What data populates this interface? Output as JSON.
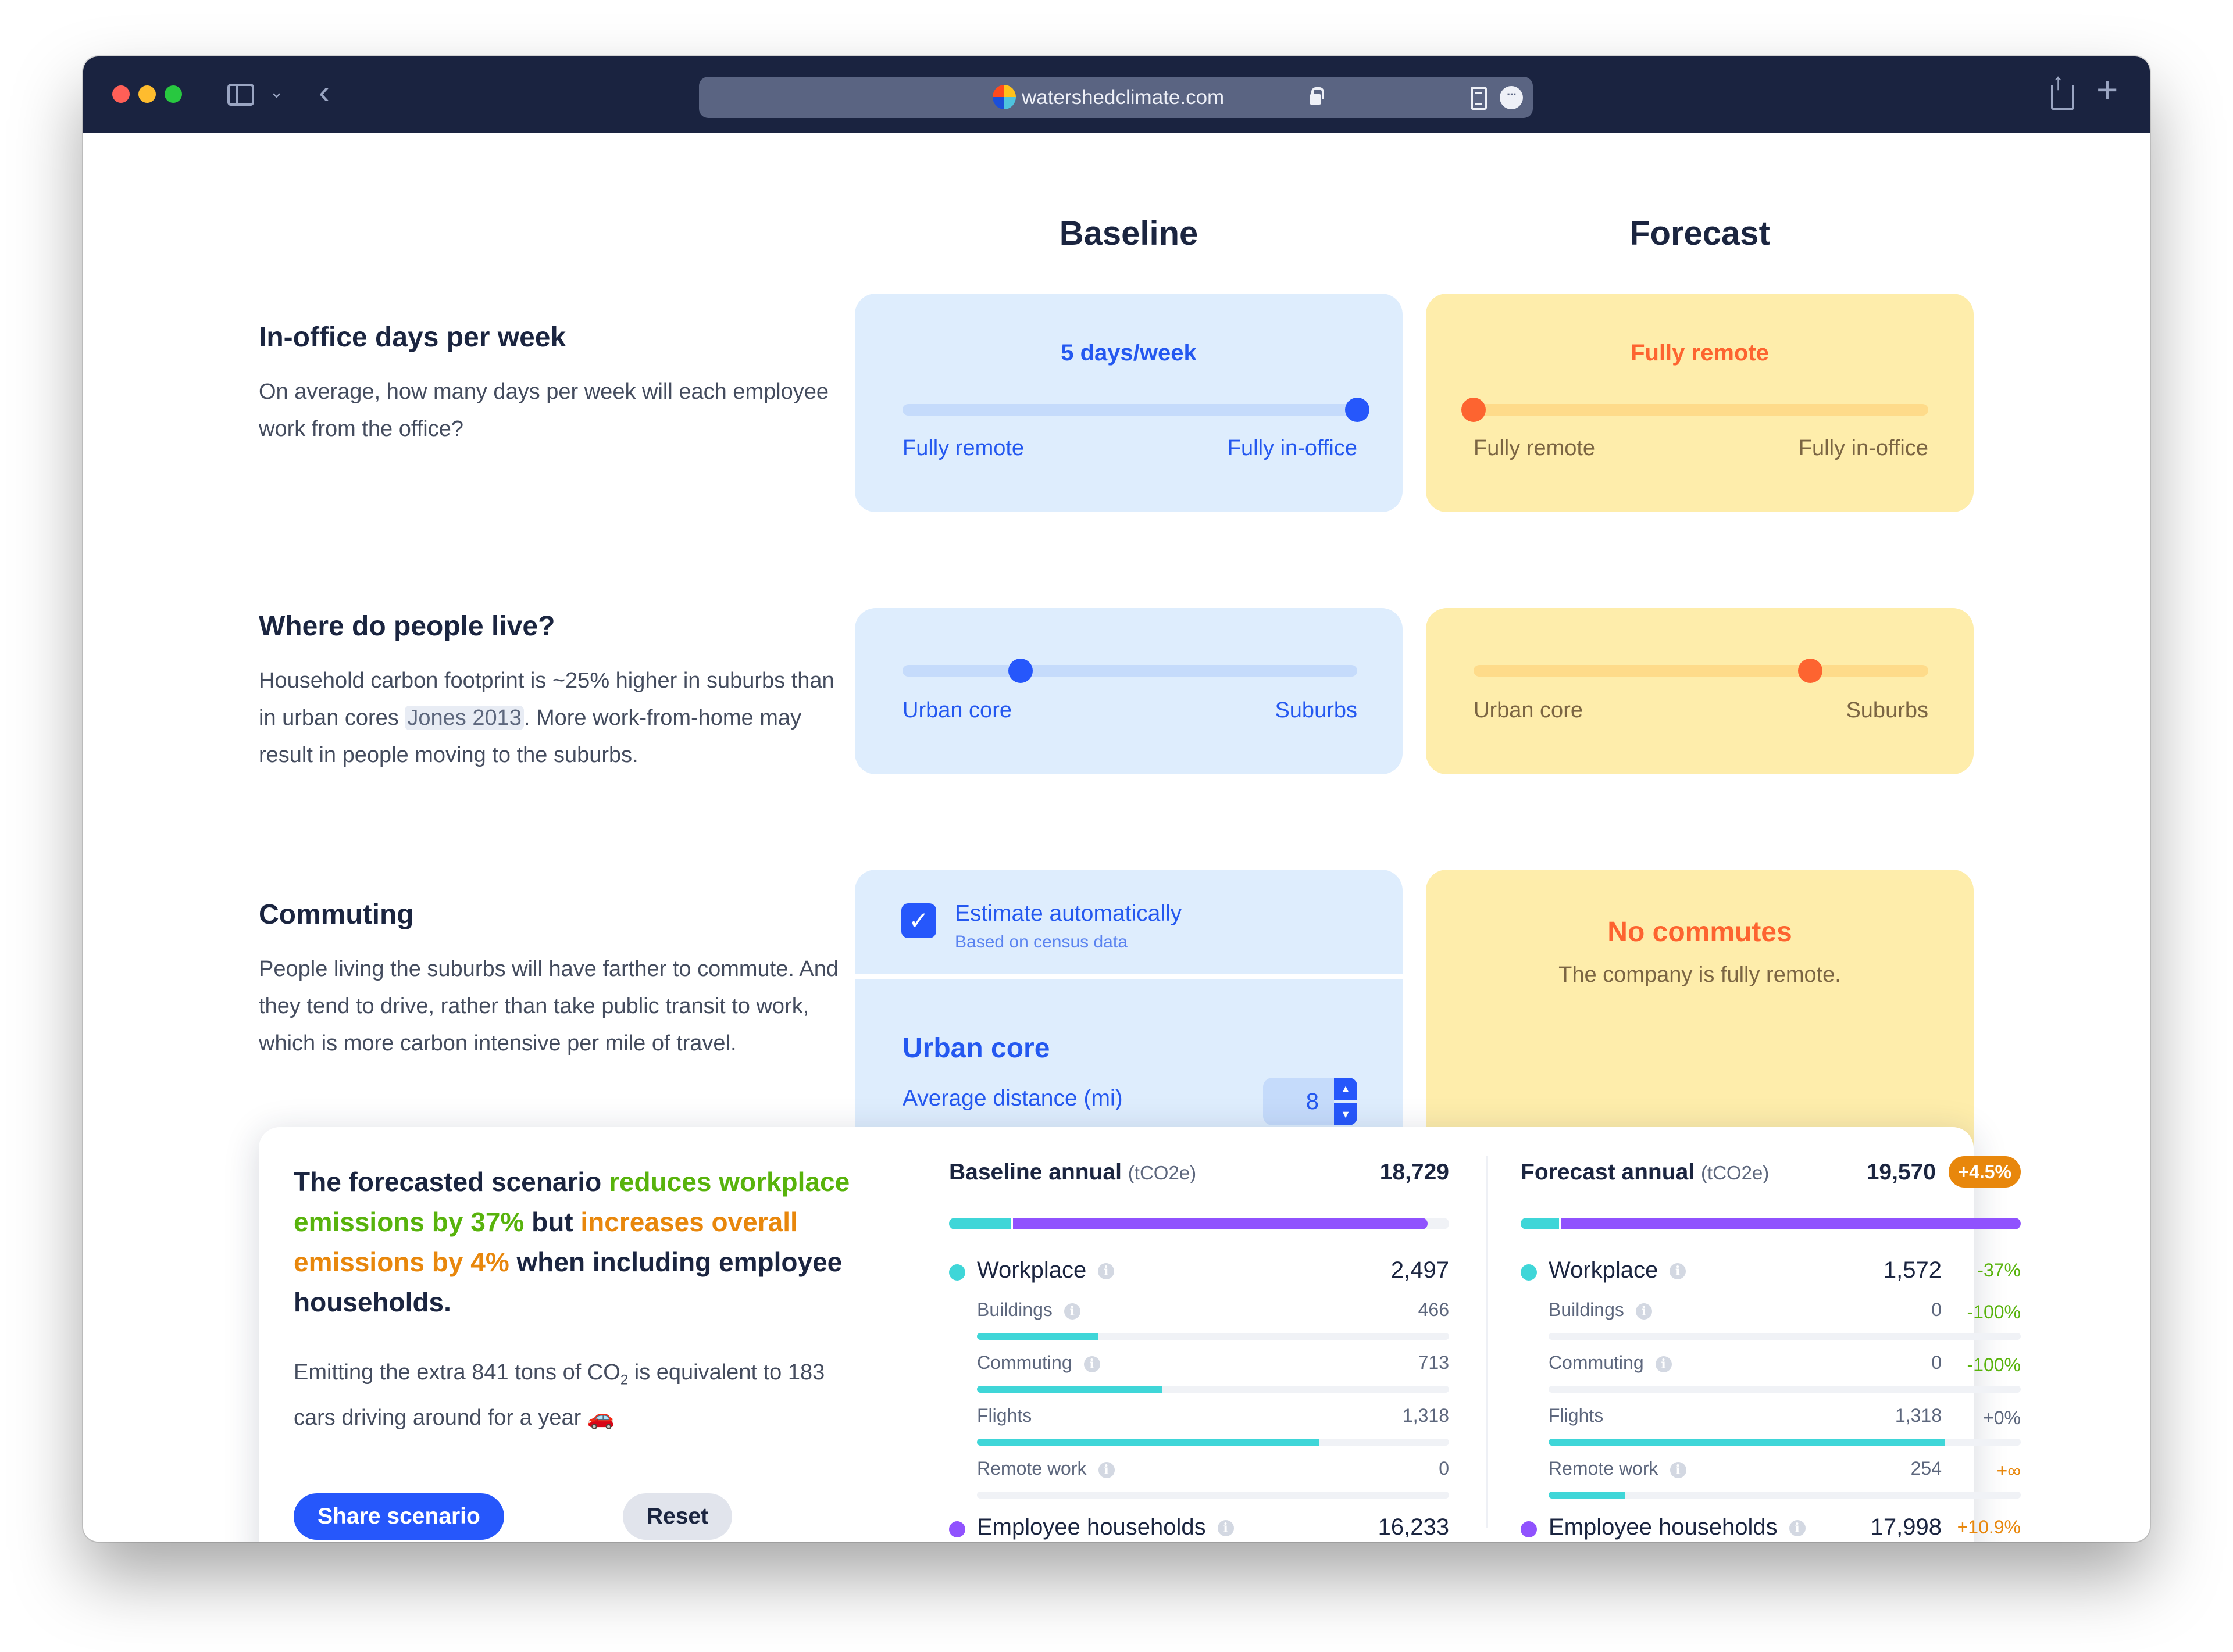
{
  "browser": {
    "url": "watershedclimate.com",
    "icons": [
      "sidebar-icon",
      "chevron-down-icon",
      "back-icon",
      "lock-icon",
      "reader-icon",
      "more-icon",
      "share-icon",
      "plus-icon"
    ]
  },
  "columns": {
    "baseline": "Baseline",
    "forecast": "Forecast"
  },
  "sections": {
    "office_days": {
      "title": "In-office days per week",
      "description": "On average, how many days per week will each employee work from the office?",
      "baseline": {
        "value_label": "5 days/week",
        "slider_fraction": 1.0,
        "min_label": "Fully remote",
        "max_label": "Fully in-office"
      },
      "forecast": {
        "value_label": "Fully remote",
        "slider_fraction": 0.0,
        "min_label": "Fully remote",
        "max_label": "Fully in-office"
      }
    },
    "residence": {
      "title": "Where do people live?",
      "description_before": "Household carbon footprint is ~25% higher in suburbs than in urban cores ",
      "citation": "Jones 2013",
      "description_after": ". More work-from-home may result in people moving to the suburbs.",
      "baseline": {
        "slider_fraction": 0.26,
        "min_label": "Urban core",
        "max_label": "Suburbs"
      },
      "forecast": {
        "slider_fraction": 0.74,
        "min_label": "Urban core",
        "max_label": "Suburbs"
      }
    },
    "commuting": {
      "title": "Commuting",
      "description": "People living the suburbs will have farther to commute. And they tend to drive, rather than take public transit to work, which is more carbon intensive per mile of travel.",
      "baseline": {
        "estimate_label": "Estimate automatically",
        "estimate_sub": "Based on census data",
        "estimate_checked": true,
        "urban_title": "Urban core",
        "distance_label": "Average distance (mi)",
        "distance_value": "8"
      },
      "forecast": {
        "title": "No commutes",
        "description": "The company is fully remote."
      }
    }
  },
  "summary": {
    "headline": {
      "part1": "The forecasted scenario ",
      "green": "reduces workplace emissions by 37%",
      "part2": " but ",
      "orange": "increases overall emissions by 4%",
      "part3": " when including employee households."
    },
    "equivalence_before": "Emitting the extra 841 tons of CO",
    "equivalence_sub": "2",
    "equivalence_after": " is equivalent to 183 cars driving around for a year 🚗",
    "share_label": "Share scenario",
    "reset_label": "Reset",
    "colors": {
      "workplace": "#3fd6d8",
      "households": "#9052fe",
      "reduce": "#58b30c",
      "increase": "#e8870c",
      "primary": "#2657fb"
    },
    "baseline": {
      "title": "Baseline annual",
      "unit": "(tCO2e)",
      "total": "18,729",
      "total_value": 18729,
      "workplace": {
        "label": "Workplace",
        "value": "2,497",
        "amount": 2497
      },
      "items": [
        {
          "label": "Buildings",
          "value": "466",
          "amount": 466,
          "info": true
        },
        {
          "label": "Commuting",
          "value": "713",
          "amount": 713,
          "info": true
        },
        {
          "label": "Flights",
          "value": "1,318",
          "amount": 1318,
          "info": false
        },
        {
          "label": "Remote work",
          "value": "0",
          "amount": 0,
          "info": true
        }
      ],
      "households": {
        "label": "Employee households",
        "value": "16,233",
        "amount": 16233
      }
    },
    "forecast": {
      "title": "Forecast annual",
      "unit": "(tCO2e)",
      "total": "19,570",
      "total_value": 19570,
      "badge": "+4.5%",
      "workplace": {
        "label": "Workplace",
        "value": "1,572",
        "amount": 1572,
        "delta": "-37%",
        "tone": "green"
      },
      "items": [
        {
          "label": "Buildings",
          "value": "0",
          "amount": 0,
          "delta": "-100%",
          "tone": "green",
          "info": true
        },
        {
          "label": "Commuting",
          "value": "0",
          "amount": 0,
          "delta": "-100%",
          "tone": "green",
          "info": true
        },
        {
          "label": "Flights",
          "value": "1,318",
          "amount": 1318,
          "delta": "+0%",
          "tone": "neutral",
          "info": false
        },
        {
          "label": "Remote work",
          "value": "254",
          "amount": 254,
          "delta": "+∞",
          "tone": "orange",
          "info": true
        }
      ],
      "households": {
        "label": "Employee households",
        "value": "17,998",
        "amount": 17998,
        "delta": "+10.9%",
        "tone": "orange"
      }
    }
  }
}
